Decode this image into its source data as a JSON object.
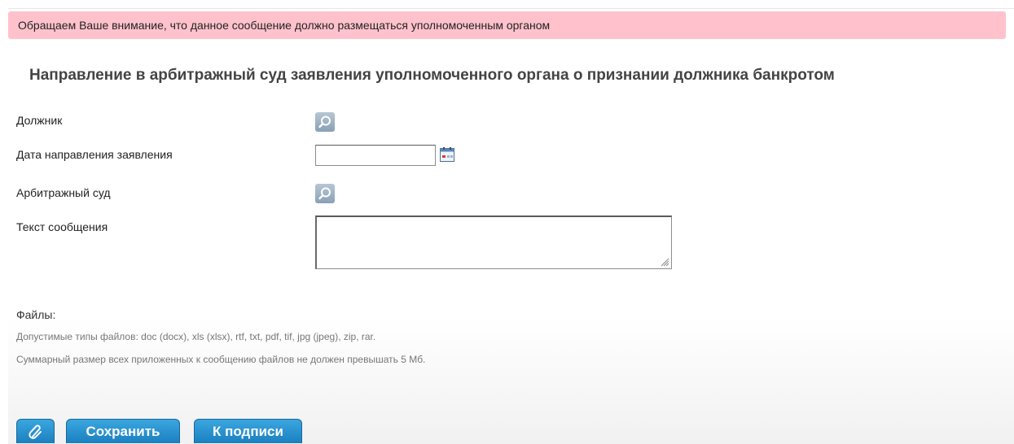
{
  "notice": {
    "text": "Обращаем Ваше внимание, что данное сообщение должно размещаться уполномоченным органом"
  },
  "page": {
    "title": "Направление в арбитражный суд заявления уполномоченного органа о признании должника банкротом"
  },
  "form": {
    "debtor_label": "Должник",
    "date_label": "Дата направления заявления",
    "date_value": "",
    "court_label": "Арбитражный суд",
    "text_label": "Текст сообщения",
    "text_value": ""
  },
  "files": {
    "title": "Файлы:",
    "allowed_types": "Допустимые типы файлов: doc (docx), xls (xlsx), rtf, txt, pdf, tif, jpg (jpeg), zip, rar.",
    "size_limit": "Суммарный размер всех приложенных к сообщению файлов не должен превышать 5 Мб."
  },
  "actions": {
    "attach_icon": "paperclip-icon",
    "save_label": "Сохранить",
    "sign_label": "К подписи"
  },
  "colors": {
    "notice_bg": "#ffc2cc",
    "button_bg": "#1f8ccc",
    "icon_bg": "#9fb3c6"
  }
}
